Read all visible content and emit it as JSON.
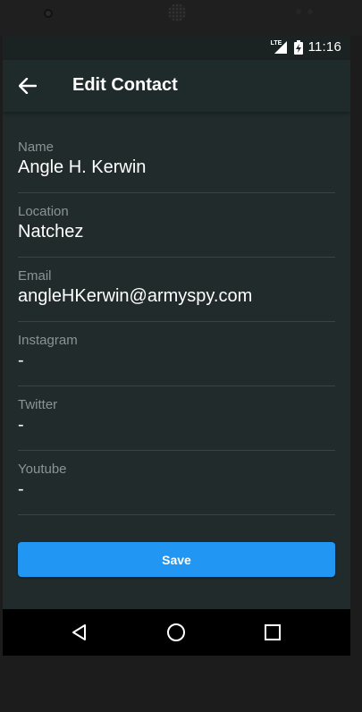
{
  "status_bar": {
    "network": "LTE",
    "time": "11:16"
  },
  "app_bar": {
    "title": "Edit Contact",
    "back_icon": "arrow-left-icon"
  },
  "form": {
    "fields": [
      {
        "label": "Name",
        "value": "Angle H. Kerwin"
      },
      {
        "label": "Location",
        "value": "Natchez"
      },
      {
        "label": "Email",
        "value": "angleHKerwin@armyspy.com"
      },
      {
        "label": "Instagram",
        "value": "-"
      },
      {
        "label": "Twitter",
        "value": "-"
      },
      {
        "label": "Youtube",
        "value": "-"
      }
    ]
  },
  "save_button": {
    "label": "Save",
    "color": "#2196f3"
  },
  "nav_bar": {
    "back_icon": "triangle-back-icon",
    "home_icon": "circle-home-icon",
    "recents_icon": "square-recents-icon"
  }
}
